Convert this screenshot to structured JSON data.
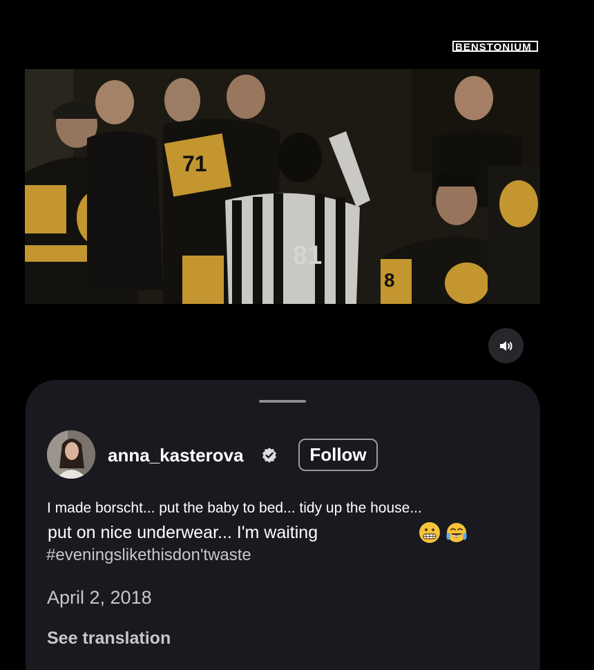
{
  "watermark": {
    "text": "BENSTONIUM"
  },
  "video": {
    "referee_number": "81",
    "player_number_left": "71",
    "player_number_right": "8"
  },
  "controls": {
    "sound_icon": "speaker-sound-icon"
  },
  "post": {
    "username": "anna_kasterova",
    "verified_icon": "verified-badge-icon",
    "follow_label": "Follow",
    "caption_line1": "I made borscht... put the baby to bed... tidy up the house...",
    "caption_line2": "put on nice underwear... I'm waiting",
    "emojis": [
      "grimacing-face-emoji",
      "tears-of-joy-emoji"
    ],
    "hashtag": "#eveningslikethisdon'twaste",
    "date": "April 2, 2018",
    "see_translation": "See translation"
  },
  "colors": {
    "background": "#000000",
    "sheet": "#181a1f",
    "muted_text": "#c6c7cb",
    "penguins_gold": "#f2b52e"
  }
}
